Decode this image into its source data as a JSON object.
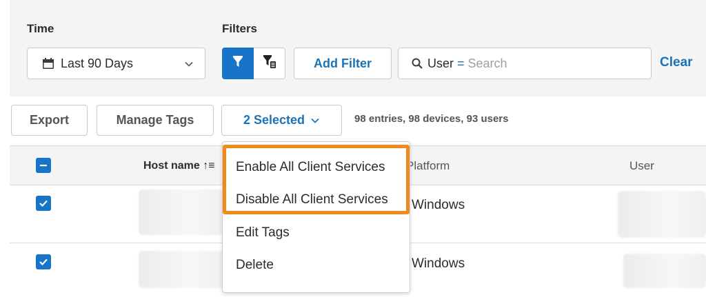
{
  "filters_panel": {
    "time_label": "Time",
    "filters_label": "Filters",
    "time_value": "Last 90 Days",
    "add_filter_label": "Add Filter",
    "search_field": "User",
    "search_operator": "=",
    "search_placeholder": "Search",
    "clear_label": "Clear"
  },
  "toolbar": {
    "export_label": "Export",
    "manage_tags_label": "Manage Tags",
    "selected_label": "2 Selected",
    "summary": "98 entries, 98 devices, 93 users"
  },
  "table": {
    "headers": {
      "host_name": "Host name",
      "sort_indicator": "↑≡",
      "platform": "Platform",
      "user": "User"
    },
    "rows": [
      {
        "platform": "Windows",
        "checked": true
      },
      {
        "platform": "Windows",
        "checked": true
      }
    ]
  },
  "dropdown_menu": {
    "items": [
      "Enable All Client Services",
      "Disable All Client Services",
      "Edit Tags",
      "Delete"
    ]
  },
  "colors": {
    "accent": "#1874c6",
    "link": "#1a73b8",
    "highlight": "#f08a1c",
    "panel_bg": "#f4f4f5"
  },
  "icons": [
    "calendar-icon",
    "chevron-down-icon",
    "funnel-icon",
    "funnel-list-icon",
    "magnifier-icon",
    "checkbox-indeterminate-icon",
    "checkbox-checked-icon"
  ]
}
